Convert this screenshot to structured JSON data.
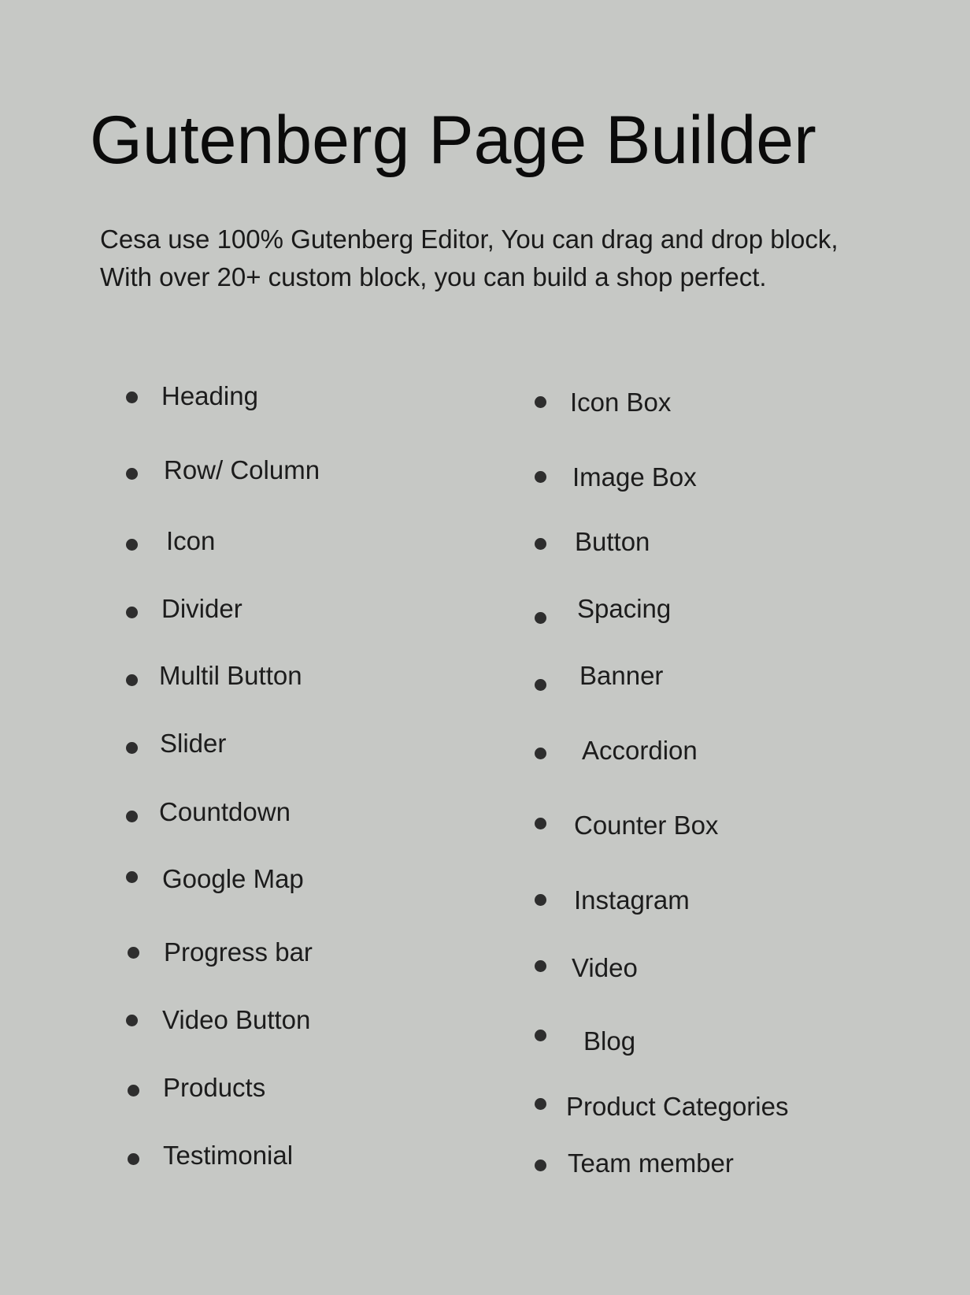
{
  "title": "Gutenberg Page Builder",
  "description": "Cesa use 100% Gutenberg Editor, You can drag and drop block, With over 20+ custom block, you can build a shop perfect.",
  "blocks": {
    "left": [
      {
        "label": "Heading"
      },
      {
        "label": "Row/ Column"
      },
      {
        "label": "Icon"
      },
      {
        "label": "Divider"
      },
      {
        "label": "Multil Button"
      },
      {
        "label": "Slider"
      },
      {
        "label": "Countdown"
      },
      {
        "label": "Google Map"
      },
      {
        "label": "Progress bar"
      },
      {
        "label": "Video Button"
      },
      {
        "label": "Products"
      },
      {
        "label": "Testimonial"
      }
    ],
    "right": [
      {
        "label": "Icon Box"
      },
      {
        "label": "Image Box"
      },
      {
        "label": "Button"
      },
      {
        "label": "Spacing"
      },
      {
        "label": "Banner"
      },
      {
        "label": "Accordion"
      },
      {
        "label": "Counter Box"
      },
      {
        "label": "Instagram"
      },
      {
        "label": "Video"
      },
      {
        "label": "Blog"
      },
      {
        "label": "Product Categories"
      },
      {
        "label": "Team member"
      }
    ]
  }
}
